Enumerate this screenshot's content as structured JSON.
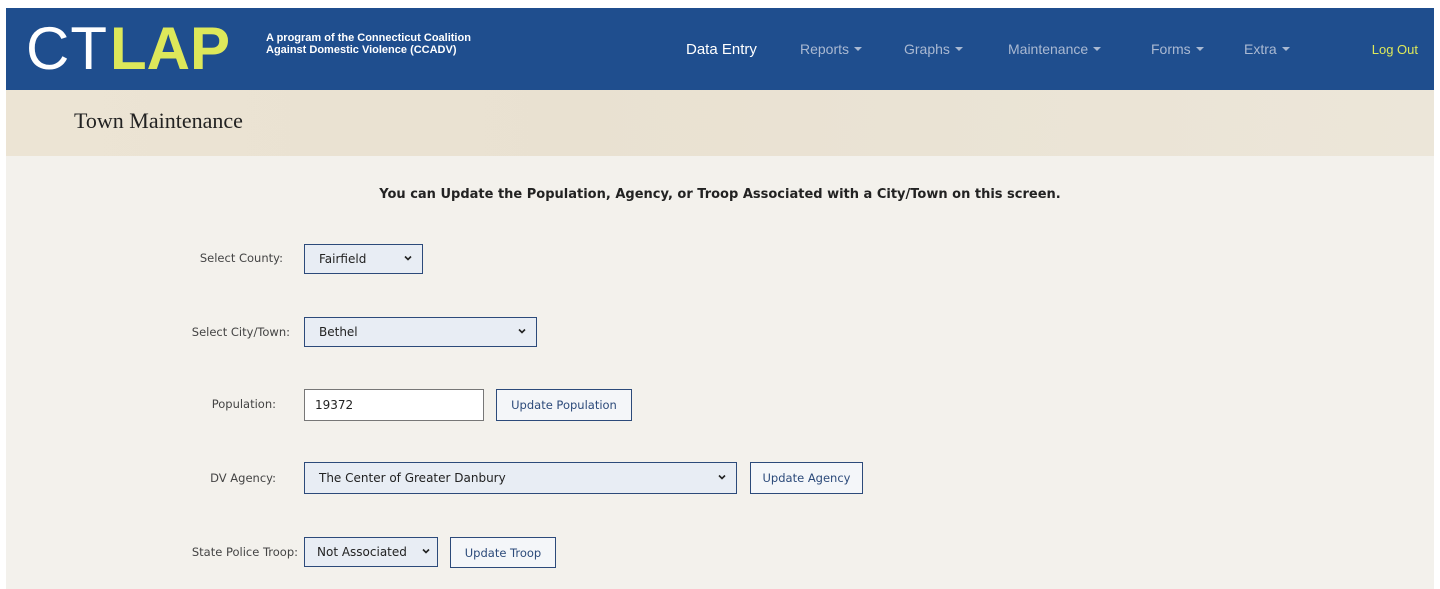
{
  "brand": {
    "logo_ct": "CT",
    "logo_lap": "LAP",
    "tagline_line1": "A program of the Connecticut Coalition",
    "tagline_line2": "Against Domestic Violence (CCADV)"
  },
  "nav": {
    "items": [
      {
        "label": "Data Entry",
        "active": true,
        "dropdown": false
      },
      {
        "label": "Reports",
        "active": false,
        "dropdown": true
      },
      {
        "label": "Graphs",
        "active": false,
        "dropdown": true
      },
      {
        "label": "Maintenance",
        "active": false,
        "dropdown": true
      },
      {
        "label": "Forms",
        "active": false,
        "dropdown": true
      },
      {
        "label": "Extra",
        "active": false,
        "dropdown": true
      }
    ],
    "logout": "Log Out"
  },
  "page": {
    "title": "Town Maintenance",
    "intro": "You can Update the Population, Agency, or Troop Associated with a City/Town on this screen."
  },
  "form": {
    "county": {
      "label": "Select County:",
      "value": "Fairfield"
    },
    "town": {
      "label": "Select City/Town:",
      "value": "Bethel"
    },
    "population": {
      "label": "Population:",
      "value": "19372",
      "button": "Update Population"
    },
    "agency": {
      "label": "DV Agency:",
      "value": "The Center of Greater Danbury",
      "button": "Update Agency"
    },
    "troop": {
      "label": "State Police Troop:",
      "value": "Not Associated",
      "button": "Update Troop"
    }
  },
  "colors": {
    "navbar": "#1f4e8e",
    "accent": "#dde85a",
    "nav_inactive": "#aab9d2",
    "control_border": "#2c4a7a"
  }
}
